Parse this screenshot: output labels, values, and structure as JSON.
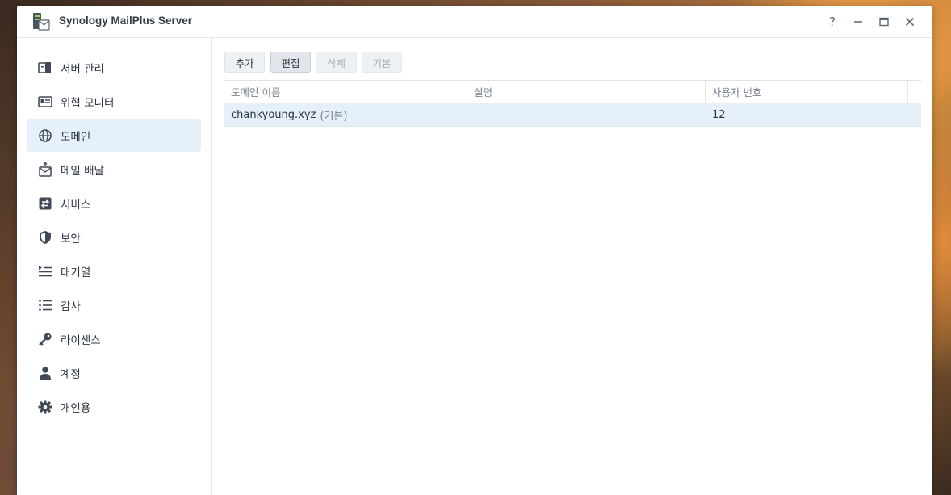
{
  "window": {
    "title": "Synology MailPlus Server",
    "controls": [
      "?",
      "—",
      "▭",
      "✕"
    ]
  },
  "sidebar": {
    "items": [
      {
        "label": "서버 관리",
        "icon": "server-management-icon"
      },
      {
        "label": "위협 모니터",
        "icon": "threat-monitor-icon"
      },
      {
        "label": "도메인",
        "icon": "globe-icon",
        "active": true
      },
      {
        "label": "메일 배달",
        "icon": "mail-delivery-icon"
      },
      {
        "label": "서비스",
        "icon": "service-icon"
      },
      {
        "label": "보안",
        "icon": "shield-icon"
      },
      {
        "label": "대기열",
        "icon": "queue-icon"
      },
      {
        "label": "감사",
        "icon": "audit-list-icon"
      },
      {
        "label": "라이센스",
        "icon": "key-icon"
      },
      {
        "label": "계정",
        "icon": "user-icon"
      },
      {
        "label": "개인용",
        "icon": "gear-icon"
      }
    ]
  },
  "toolbar": {
    "add": "추가",
    "edit": "편집",
    "delete": "삭제",
    "default": "기본"
  },
  "table": {
    "columns": [
      "도메인 이름",
      "설명",
      "사용자 번호"
    ],
    "rows": [
      {
        "domain": "chankyoung.xyz",
        "tag": "(기본)",
        "description": "",
        "users": "12"
      }
    ]
  },
  "colors": {
    "accent": "#e5f0fb",
    "text": "#2c3440"
  }
}
